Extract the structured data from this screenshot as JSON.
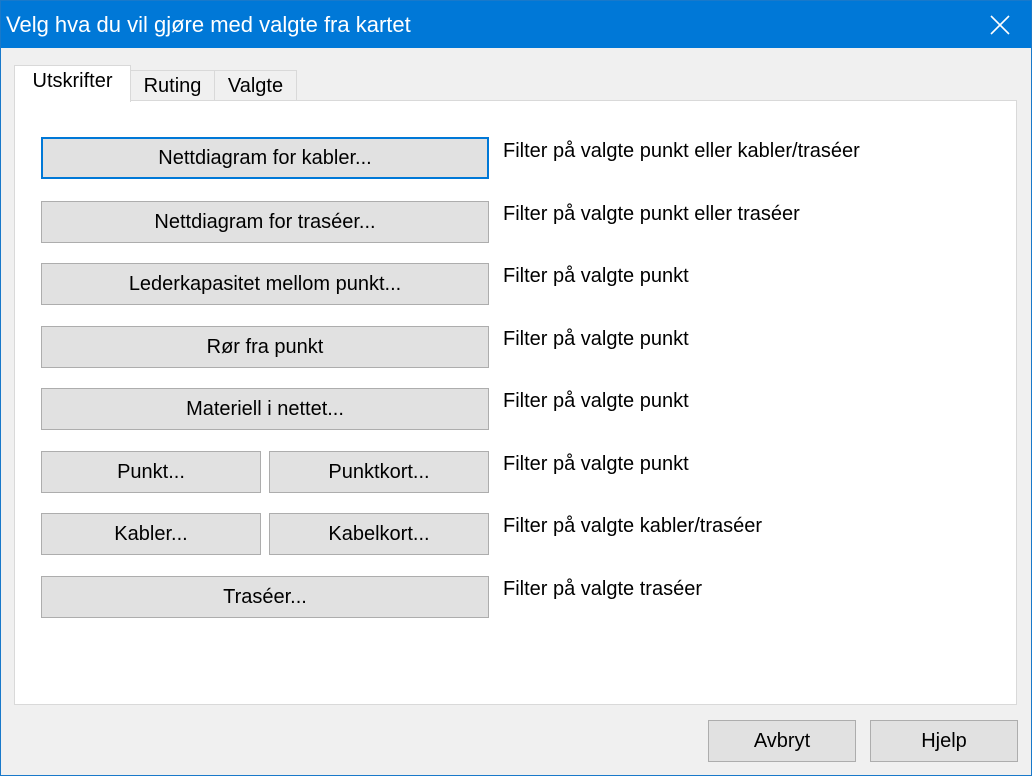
{
  "window": {
    "title": "Velg hva du vil gjøre med valgte fra kartet",
    "close_icon": "close-icon"
  },
  "tabs": [
    {
      "label": "Utskrifter",
      "active": true
    },
    {
      "label": "Ruting",
      "active": false
    },
    {
      "label": "Valgte",
      "active": false
    }
  ],
  "rows": [
    {
      "buttons": [
        "Nettdiagram for kabler..."
      ],
      "description": "Filter på valgte punkt eller kabler/traséer"
    },
    {
      "buttons": [
        "Nettdiagram for traséer..."
      ],
      "description": "Filter på valgte punkt eller traséer"
    },
    {
      "buttons": [
        "Lederkapasitet mellom punkt..."
      ],
      "description": "Filter på valgte punkt"
    },
    {
      "buttons": [
        "Rør fra punkt"
      ],
      "description": "Filter på valgte punkt"
    },
    {
      "buttons": [
        "Materiell i nettet..."
      ],
      "description": "Filter på valgte punkt"
    },
    {
      "buttons": [
        "Punkt...",
        "Punktkort..."
      ],
      "description": "Filter på valgte punkt"
    },
    {
      "buttons": [
        "Kabler...",
        "Kabelkort..."
      ],
      "description": "Filter på valgte kabler/traséer"
    },
    {
      "buttons": [
        "Traséer..."
      ],
      "description": "Filter på valgte traséer"
    }
  ],
  "footer": {
    "cancel_label": "Avbryt",
    "help_label": "Hjelp"
  },
  "colors": {
    "titlebar": "#0078d7",
    "button_face": "#e1e1e1",
    "focus_border": "#0078d7"
  }
}
